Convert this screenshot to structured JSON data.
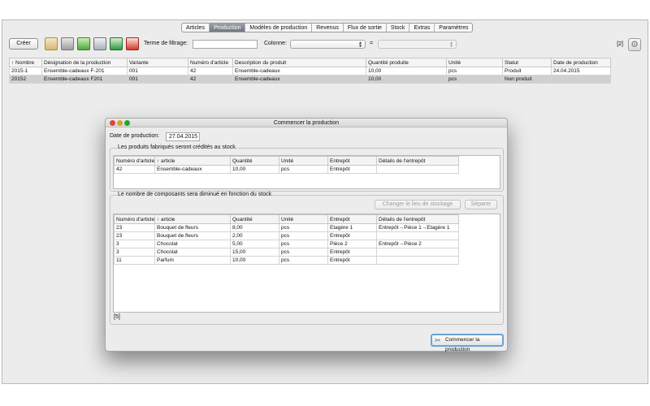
{
  "tabs": [
    "Articles",
    "Production",
    "Modèles de production",
    "Revenus",
    "Flux de sortie",
    "Stock",
    "Extras",
    "Paramètres"
  ],
  "active_tab": "Production",
  "toolbar": {
    "create_label": "Créer",
    "filter_label": "Terme de filtrage:",
    "filter_value": "",
    "column_label": "Colonne:",
    "equals_label": "=",
    "count": "[2]"
  },
  "main_table": {
    "headers": [
      "↑ Nombre",
      "Désignation de la production",
      "Variante",
      "Numéro d'article",
      "Description du produit",
      "Quantité produite",
      "Unité",
      "Statut",
      "Date de production"
    ],
    "rows": [
      [
        "2015-1",
        "Ensemble-cadeaux F-201",
        "001",
        "42",
        "Ensemble-cadeaux",
        "10,00",
        "pcs",
        "Produit",
        "24.04.2015"
      ],
      [
        "20152",
        "Ensemble-cadeaux F201",
        "001",
        "42",
        "Ensemble-cadeaux",
        "10,00",
        "pcs",
        "Non produit",
        ""
      ]
    ]
  },
  "dialog": {
    "title": "Commencer la production",
    "date_label": "Date de production:",
    "date_value": "27.04.2015",
    "products_group": "Les produits fabriqués seront crédités au stock.",
    "products_headers": [
      "Numéro d'article",
      "↑ article",
      "Quantité",
      "Unité",
      "Entrepôt",
      "Détails de l'entrepôt"
    ],
    "products_rows": [
      [
        "42",
        "Ensemble-cadeaux",
        "10,00",
        "pcs",
        "Entrepôt",
        ""
      ]
    ],
    "components_group": "Le nombre de composants sera diminué en fonction du stock.",
    "change_storage_label": "Changer le lieu de stockage",
    "split_label": "Séparer",
    "components_headers": [
      "Numéro d'article",
      "↑ article",
      "Quantité",
      "Unité",
      "Entrepôt",
      "Détails de l'entrepôt"
    ],
    "components_rows": [
      [
        "23",
        "Bouquet de fleurs",
        "8,00",
        "pcs",
        "Etagère 1",
        "Entrepôt→Pièce 1→Etagère 1"
      ],
      [
        "23",
        "Bouquet de fleurs",
        "2,00",
        "pcs",
        "Entrepôt",
        ""
      ],
      [
        "3",
        "Chocolat",
        "5,00",
        "pcs",
        "Pièce 2",
        "Entrepôt→Pièce 2"
      ],
      [
        "3",
        "Chocolat",
        "15,00",
        "pcs",
        "Entrepôt",
        ""
      ],
      [
        "11",
        "Parfum",
        "10,00",
        "pcs",
        "Entrepôt",
        ""
      ]
    ],
    "components_count": "[5]",
    "start_label": "Commencer la production"
  },
  "colors": {
    "selected_row": "#d0d0d0",
    "close_light": "#e0443e",
    "min_light": "#dea123",
    "zoom_light": "#1aab29",
    "focus_ring": "#6aa2d8"
  }
}
